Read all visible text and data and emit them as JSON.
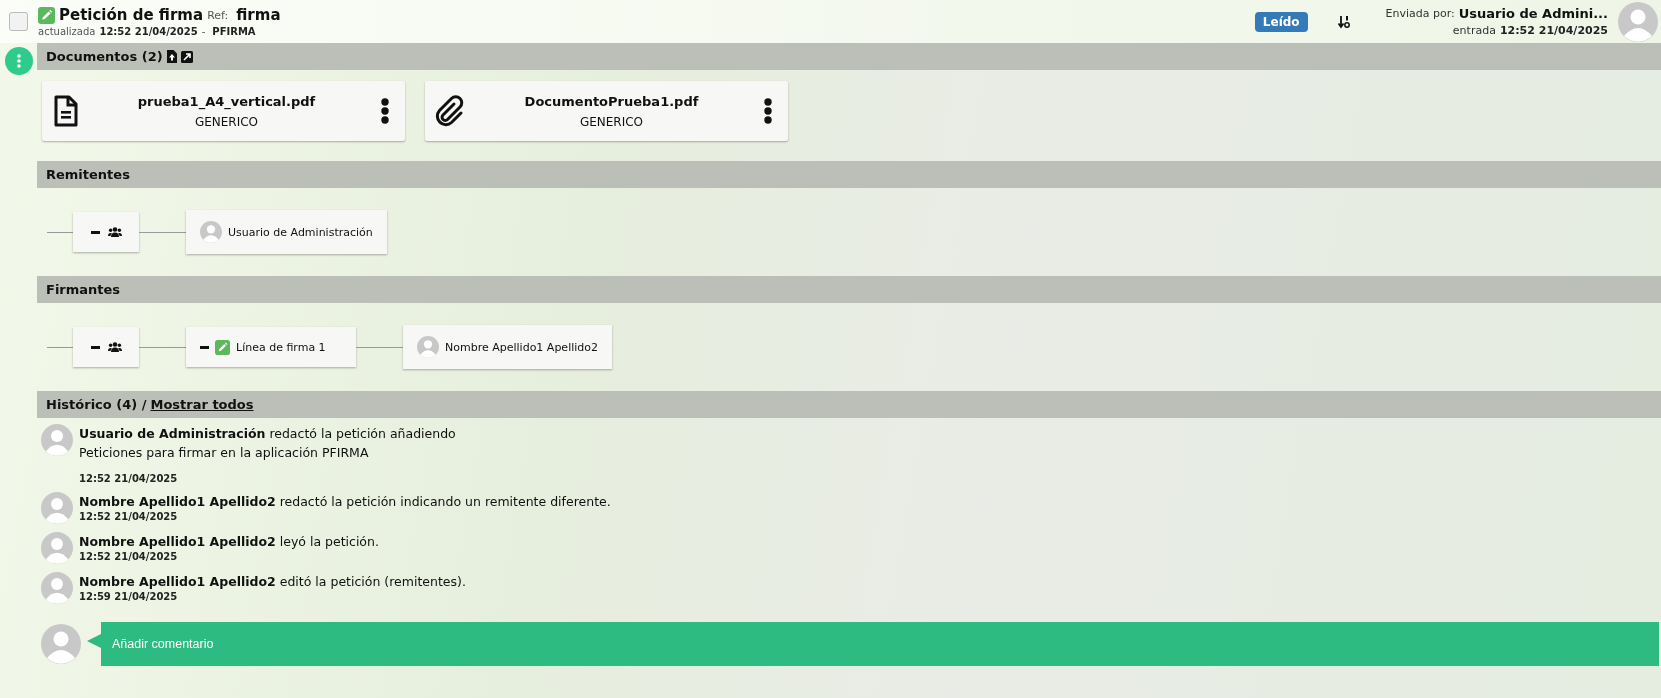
{
  "header": {
    "checked": false,
    "title": "Petición de firma",
    "ref_label": "Ref:",
    "ref": "firma",
    "updated_label": "actualizada",
    "updated": "12:52 21/04/2025",
    "separator": "-",
    "app": "PFIRMA",
    "status_badge": "Leído",
    "sent_by_label": "Enviada por:",
    "sent_by": "Usuario de Admini...",
    "entry_label": "entrada",
    "entry": "12:52 21/04/2025"
  },
  "documents": {
    "title": "Documentos (2)",
    "items": [
      {
        "kind": "document",
        "name": "prueba1_A4_vertical.pdf",
        "type": "GENERICO"
      },
      {
        "kind": "attachment",
        "name": "DocumentoPrueba1.pdf",
        "type": "GENERICO"
      }
    ]
  },
  "senders": {
    "title": "Remitentes",
    "nodes": [
      {
        "kind": "group"
      },
      {
        "kind": "user",
        "label": "Usuario de Administración"
      }
    ]
  },
  "signers": {
    "title": "Firmantes",
    "nodes": [
      {
        "kind": "group"
      },
      {
        "kind": "line",
        "label": "Línea de firma 1"
      },
      {
        "kind": "user",
        "label": "Nombre Apellido1 Apellido2"
      }
    ]
  },
  "history": {
    "title": "Histórico (4) /",
    "show_all": "Mostrar todos",
    "entries": [
      {
        "text": "**Usuario de Administración** redactó la petición añadiendo",
        "note": "Peticiones para firmar en la aplicación PFIRMA",
        "time": "12:52 21/04/2025"
      },
      {
        "text": "**Nombre Apellido1 Apellido2** redactó la petición indicando un remitente diferente.",
        "time": "12:52 21/04/2025"
      },
      {
        "text": "**Nombre Apellido1 Apellido2** leyó la petición.",
        "time": "12:52 21/04/2025"
      },
      {
        "text": "**Nombre Apellido1 Apellido2** editó la petición (remitentes).",
        "time": "12:59 21/04/2025"
      }
    ]
  },
  "comment": {
    "placeholder": "Añadir comentario"
  }
}
